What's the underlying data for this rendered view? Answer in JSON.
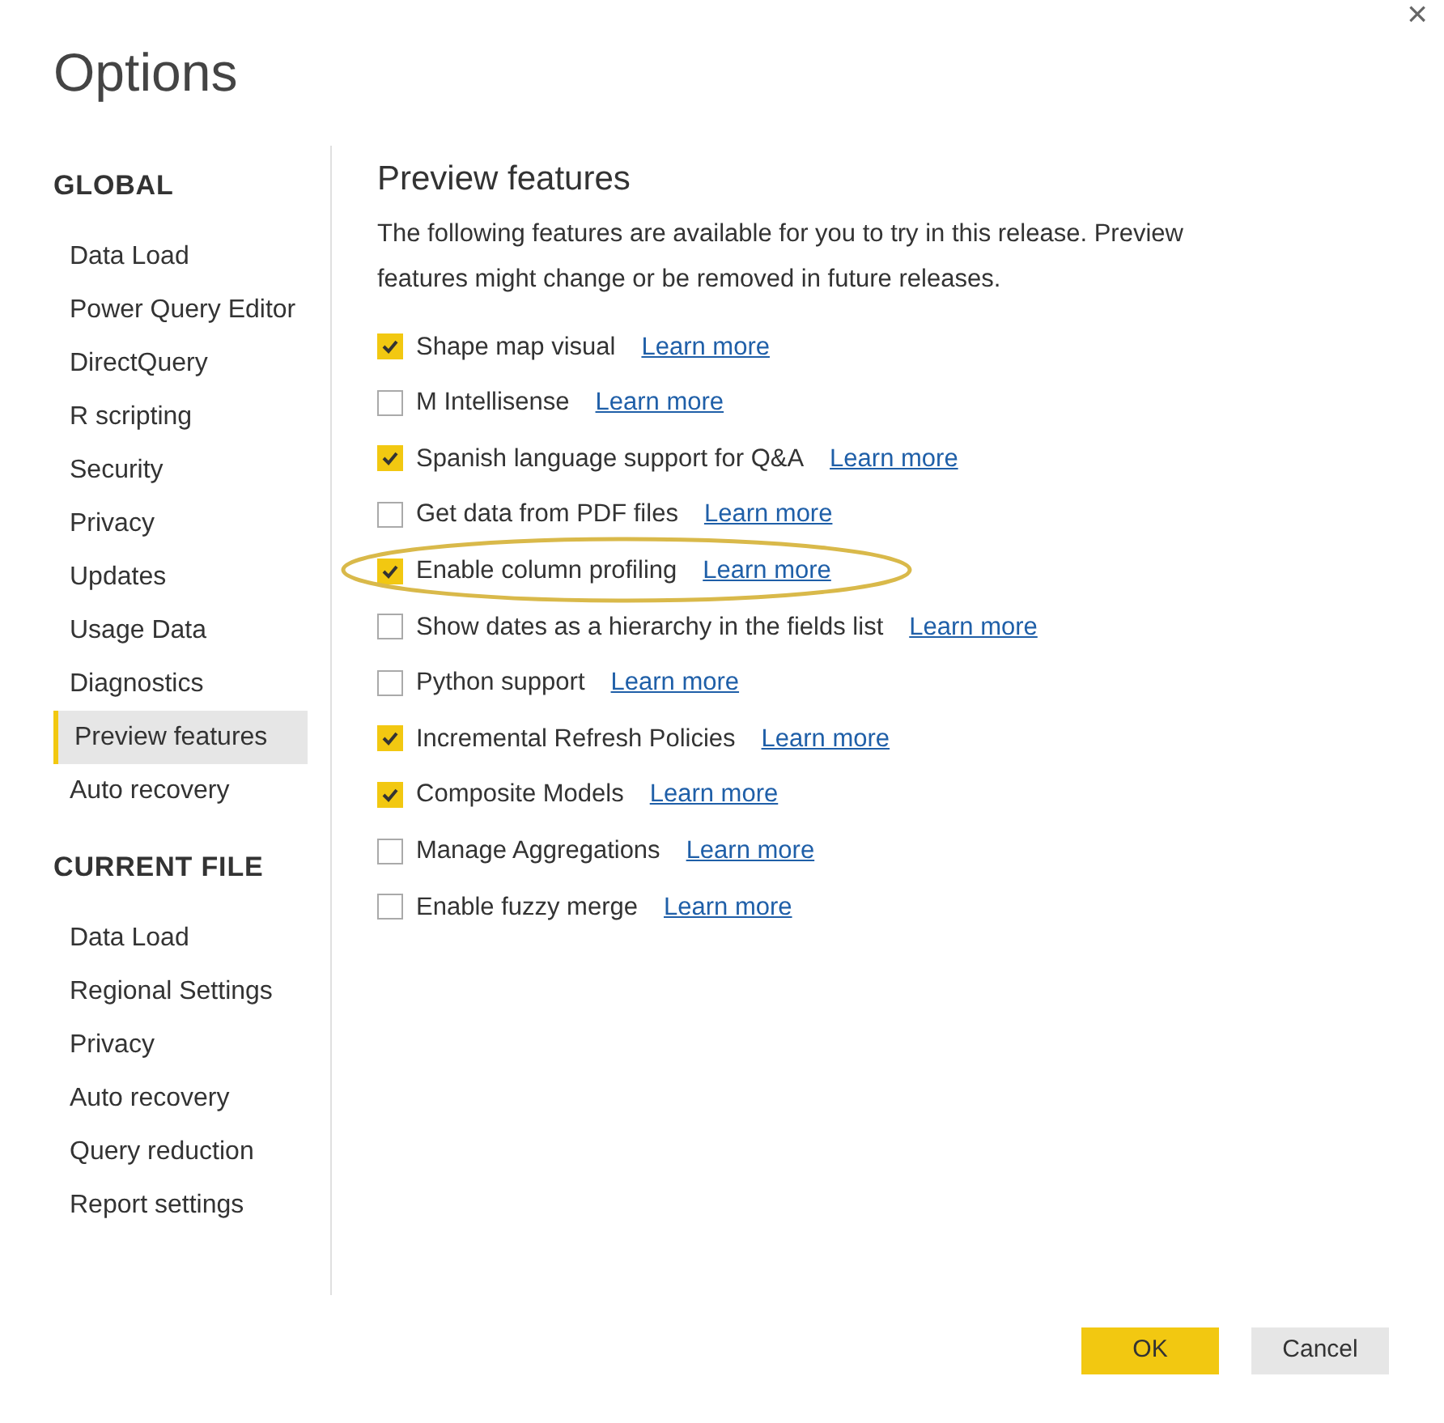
{
  "window": {
    "title": "Options",
    "close": "×"
  },
  "sidebar": {
    "sections": [
      {
        "heading": "GLOBAL",
        "items": [
          {
            "label": "Data Load",
            "selected": false
          },
          {
            "label": "Power Query Editor",
            "selected": false
          },
          {
            "label": "DirectQuery",
            "selected": false
          },
          {
            "label": "R scripting",
            "selected": false
          },
          {
            "label": "Security",
            "selected": false
          },
          {
            "label": "Privacy",
            "selected": false
          },
          {
            "label": "Updates",
            "selected": false
          },
          {
            "label": "Usage Data",
            "selected": false
          },
          {
            "label": "Diagnostics",
            "selected": false
          },
          {
            "label": "Preview features",
            "selected": true
          },
          {
            "label": "Auto recovery",
            "selected": false
          }
        ]
      },
      {
        "heading": "CURRENT FILE",
        "items": [
          {
            "label": "Data Load",
            "selected": false
          },
          {
            "label": "Regional Settings",
            "selected": false
          },
          {
            "label": "Privacy",
            "selected": false
          },
          {
            "label": "Auto recovery",
            "selected": false
          },
          {
            "label": "Query reduction",
            "selected": false
          },
          {
            "label": "Report settings",
            "selected": false
          }
        ]
      }
    ]
  },
  "main": {
    "heading": "Preview features",
    "description": "The following features are available for you to try in this release. Preview features might change or be removed in future releases.",
    "features": [
      {
        "label": "Shape map visual",
        "checked": true,
        "link": "Learn more",
        "highlighted": false
      },
      {
        "label": "M Intellisense",
        "checked": false,
        "link": "Learn more",
        "highlighted": false
      },
      {
        "label": "Spanish language support for Q&A",
        "checked": true,
        "link": "Learn more",
        "highlighted": false
      },
      {
        "label": "Get data from PDF files",
        "checked": false,
        "link": "Learn more",
        "highlighted": false
      },
      {
        "label": "Enable column profiling",
        "checked": true,
        "link": "Learn more",
        "highlighted": true
      },
      {
        "label": "Show dates as a hierarchy in the fields list",
        "checked": false,
        "link": "Learn more",
        "highlighted": false
      },
      {
        "label": "Python support",
        "checked": false,
        "link": "Learn more",
        "highlighted": false
      },
      {
        "label": "Incremental Refresh Policies",
        "checked": true,
        "link": "Learn more",
        "highlighted": false
      },
      {
        "label": "Composite Models",
        "checked": true,
        "link": "Learn more",
        "highlighted": false
      },
      {
        "label": "Manage Aggregations",
        "checked": false,
        "link": "Learn more",
        "highlighted": false
      },
      {
        "label": "Enable fuzzy merge",
        "checked": false,
        "link": "Learn more",
        "highlighted": false
      }
    ]
  },
  "buttons": [
    {
      "label": "OK",
      "kind": "primary"
    },
    {
      "label": "Cancel",
      "kind": "secondary"
    }
  ]
}
